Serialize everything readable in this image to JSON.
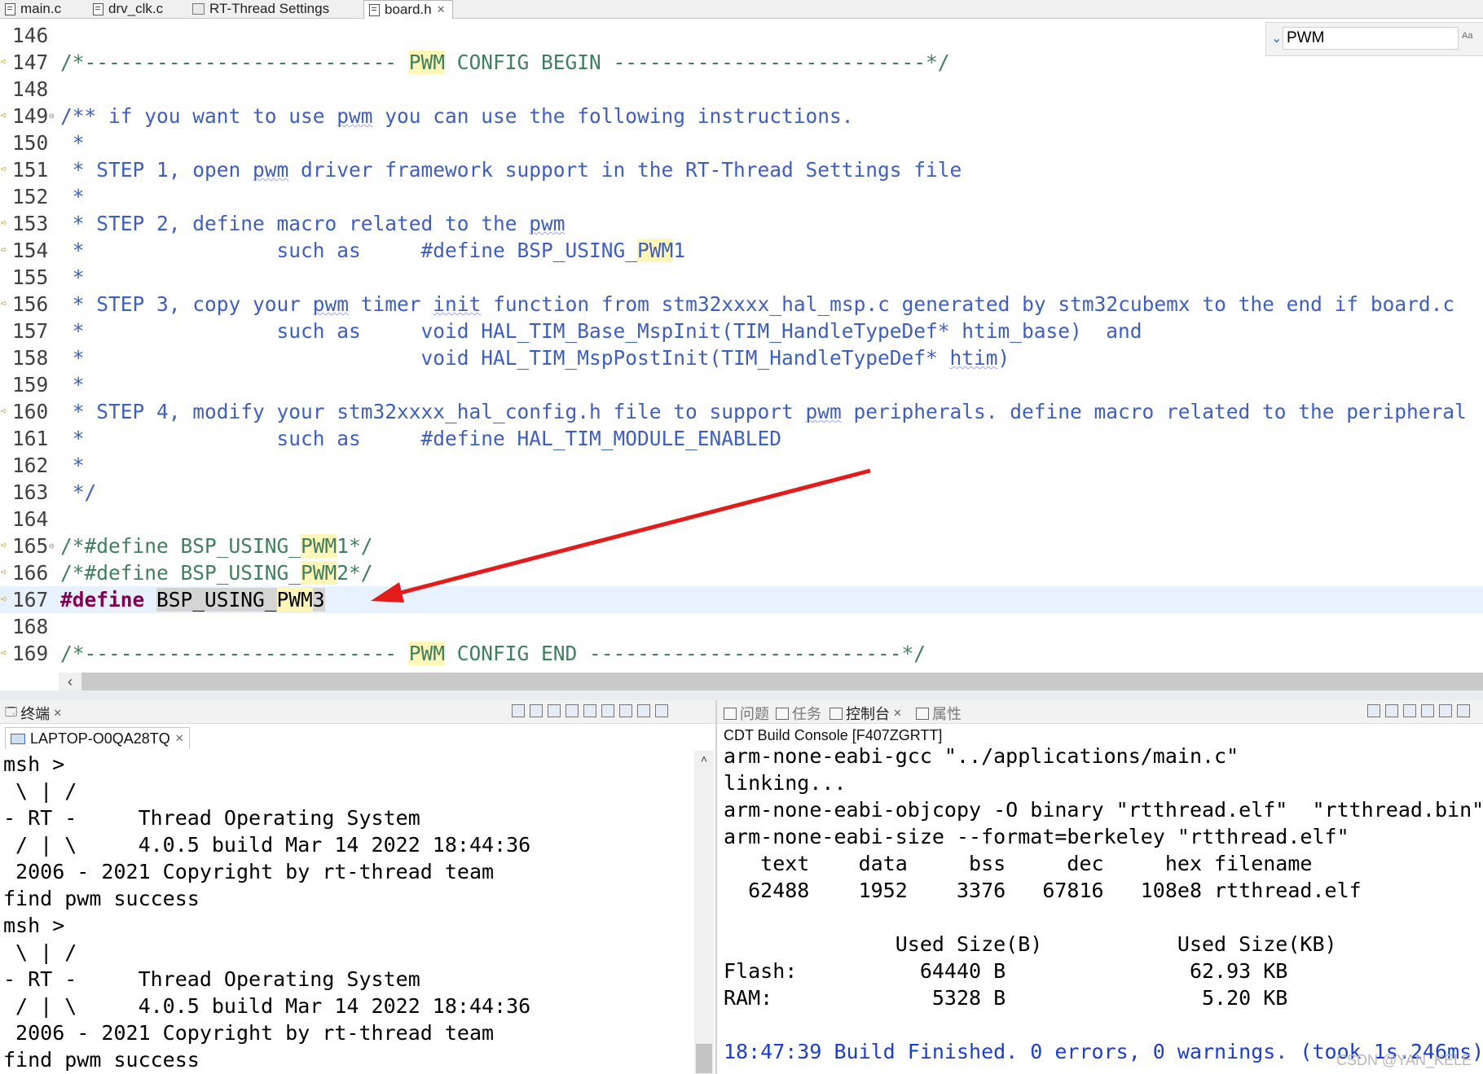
{
  "editor_tabs": [
    {
      "label": "main.c",
      "active": false
    },
    {
      "label": "drv_clk.c",
      "active": false
    },
    {
      "label": "RT-Thread Settings",
      "active": false
    },
    {
      "label": "board.h",
      "active": true
    }
  ],
  "find": {
    "value": "PWM"
  },
  "code_lines": [
    {
      "num": "146",
      "text": ""
    },
    {
      "num": "147",
      "text": "/*-------------------------- PWM CONFIG BEGIN --------------------------*/"
    },
    {
      "num": "148",
      "text": ""
    },
    {
      "num": "149",
      "text": "/** if you want to use pwm you can use the following instructions."
    },
    {
      "num": "150",
      "text": " *"
    },
    {
      "num": "151",
      "text": " * STEP 1, open pwm driver framework support in the RT-Thread Settings file"
    },
    {
      "num": "152",
      "text": " *"
    },
    {
      "num": "153",
      "text": " * STEP 2, define macro related to the pwm"
    },
    {
      "num": "154",
      "text": " *                such as     #define BSP_USING_PWM1"
    },
    {
      "num": "155",
      "text": " *"
    },
    {
      "num": "156",
      "text": " * STEP 3, copy your pwm timer init function from stm32xxxx_hal_msp.c generated by stm32cubemx to the end if board.c"
    },
    {
      "num": "157",
      "text": " *                such as     void HAL_TIM_Base_MspInit(TIM_HandleTypeDef* htim_base)  and"
    },
    {
      "num": "158",
      "text": " *                            void HAL_TIM_MspPostInit(TIM_HandleTypeDef* htim)"
    },
    {
      "num": "159",
      "text": " *"
    },
    {
      "num": "160",
      "text": " * STEP 4, modify your stm32xxxx_hal_config.h file to support pwm peripherals. define macro related to the peripheral"
    },
    {
      "num": "161",
      "text": " *                such as     #define HAL_TIM_MODULE_ENABLED"
    },
    {
      "num": "162",
      "text": " *"
    },
    {
      "num": "163",
      "text": " */"
    },
    {
      "num": "164",
      "text": ""
    },
    {
      "num": "165",
      "text": "/*#define BSP_USING_PWM1*/"
    },
    {
      "num": "166",
      "text": "/*#define BSP_USING_PWM2*/"
    },
    {
      "num": "167",
      "text": "#define BSP_USING_PWM3"
    },
    {
      "num": "168",
      "text": ""
    },
    {
      "num": "169",
      "text": "/*-------------------------- PWM CONFIG END --------------------------*/"
    }
  ],
  "terminal_panel": {
    "tab_label": "终端",
    "session_label": "LAPTOP-O0QA28TQ",
    "lines": [
      "msh >",
      " \\ | /",
      "- RT -     Thread Operating System",
      " / | \\     4.0.5 build Mar 14 2022 18:44:36",
      " 2006 - 2021 Copyright by rt-thread team",
      "find pwm success",
      "msh >",
      " \\ | /",
      "- RT -     Thread Operating System",
      " / | \\     4.0.5 build Mar 14 2022 18:44:36",
      " 2006 - 2021 Copyright by rt-thread team",
      "find pwm success"
    ]
  },
  "console_panel": {
    "tabs": [
      {
        "label": "问题",
        "active": false
      },
      {
        "label": "任务",
        "active": false
      },
      {
        "label": "控制台",
        "active": true
      },
      {
        "label": "属性",
        "active": false
      }
    ],
    "title": "CDT Build Console [F407ZGRTT]",
    "lines": [
      "arm-none-eabi-gcc \"../applications/main.c\"",
      "linking...",
      "arm-none-eabi-objcopy -O binary \"rtthread.elf\"  \"rtthread.bin\"",
      "arm-none-eabi-size --format=berkeley \"rtthread.elf\"",
      "   text    data     bss     dec     hex filename",
      "  62488    1952    3376   67816   108e8 rtthread.elf",
      "",
      "              Used Size(B)           Used Size(KB)",
      "Flash:          64440 B               62.93 KB",
      "RAM:             5328 B                5.20 KB",
      "",
      "18:47:39 Build Finished. 0 errors, 0 warnings. (took 1s.246ms)"
    ]
  },
  "watermark": "CSDN @YAN_KELE",
  "icons": {
    "tab_file": "file-c-icon",
    "tab_settings": "settings-file-icon",
    "line_marker": "change-marker-icon",
    "find_dropdown": "chevron-down-icon",
    "terminal_tab": "terminal-icon",
    "console_tab": "console-icon",
    "annotation": "red-arrow-icon"
  },
  "colors": {
    "comment": "#3f7f5f",
    "doc_comment": "#3f5fbf",
    "keyword": "#7f0055",
    "search_highlight": "#fff6b8",
    "current_line": "#e8f2fe",
    "build_finished": "#1c3ecd",
    "annotation_arrow": "#e31b1b"
  }
}
